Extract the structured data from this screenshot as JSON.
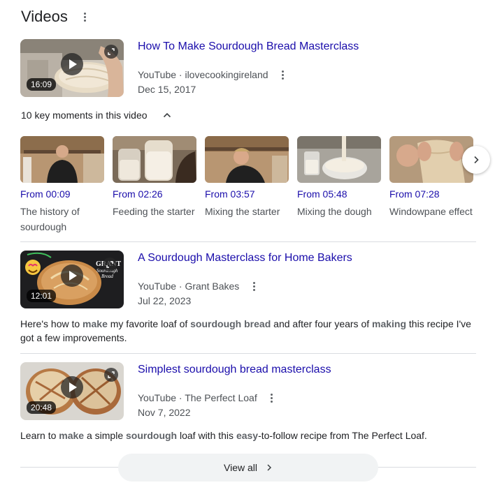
{
  "header": {
    "title": "Videos"
  },
  "videos": [
    {
      "title": "How To Make Sourdough Bread Masterclass",
      "source": "YouTube · ilovecookingireland",
      "date": "Dec 15, 2017",
      "duration": "16:09"
    },
    {
      "title": "A Sourdough Masterclass for Home Bakers",
      "source": "YouTube · Grant Bakes",
      "date": "Jul 22, 2023",
      "duration": "12:01",
      "thumb_text": [
        "GRANT",
        "Sourdough",
        "Bread"
      ],
      "desc": [
        {
          "t": "Here's how to ",
          "b": false
        },
        {
          "t": "make",
          "b": true
        },
        {
          "t": " my favorite loaf of ",
          "b": false
        },
        {
          "t": "sourdough bread",
          "b": true
        },
        {
          "t": " and after four years of ",
          "b": false
        },
        {
          "t": "making",
          "b": true
        },
        {
          "t": " this recipe I've got a few improvements.",
          "b": false
        }
      ]
    },
    {
      "title": "Simplest sourdough bread masterclass",
      "source": "YouTube · The Perfect Loaf",
      "date": "Nov 7, 2022",
      "duration": "20:48",
      "desc": [
        {
          "t": "Learn to ",
          "b": false
        },
        {
          "t": "make",
          "b": true
        },
        {
          "t": " a simple ",
          "b": false
        },
        {
          "t": "sourdough",
          "b": true
        },
        {
          "t": " loaf with this ",
          "b": false
        },
        {
          "t": "easy",
          "b": true
        },
        {
          "t": "-to-follow recipe from The Perfect Loaf.",
          "b": false
        }
      ]
    }
  ],
  "key_moments": {
    "heading": "10 key moments in this video",
    "items": [
      {
        "from": "From 00:09",
        "label": "The history of sourdough"
      },
      {
        "from": "From 02:26",
        "label": "Feeding the starter"
      },
      {
        "from": "From 03:57",
        "label": "Mixing the starter"
      },
      {
        "from": "From 05:48",
        "label": "Mixing the dough"
      },
      {
        "from": "From 07:28",
        "label": "Windowpane effect"
      }
    ]
  },
  "footer": {
    "view_all": "View all"
  },
  "colors": {
    "link": "#1a0dab",
    "meta": "#4d5156",
    "divider": "#dadce0",
    "button_bg": "#f1f3f4"
  },
  "icons": [
    "more-vert-icon",
    "play-icon",
    "expand-icon",
    "chevron-up-icon",
    "chevron-right-icon"
  ]
}
